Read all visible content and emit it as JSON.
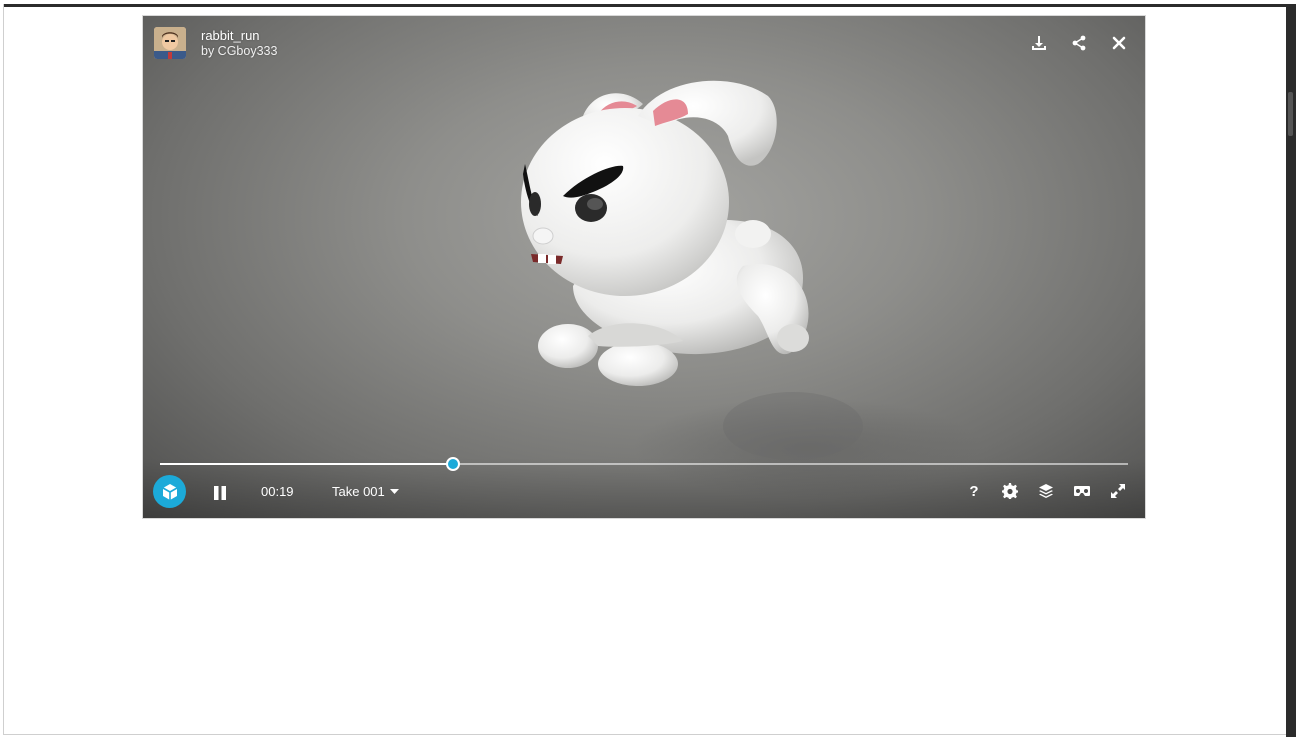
{
  "model": {
    "title": "rabbit_run",
    "author_line": "by CGboy333"
  },
  "top_actions": [
    {
      "name": "download-icon"
    },
    {
      "name": "share-icon"
    },
    {
      "name": "close-icon"
    }
  ],
  "player": {
    "time": "00:19",
    "take_label": "Take 001",
    "progress": 0.303
  },
  "bottom_actions": [
    {
      "name": "help-icon",
      "glyph": "?"
    },
    {
      "name": "settings-icon"
    },
    {
      "name": "layers-icon"
    },
    {
      "name": "vr-icon"
    },
    {
      "name": "fullscreen-icon"
    }
  ],
  "colors": {
    "accent": "#1caad9",
    "background_outer": "#ffffff",
    "viewer_center": "#a4a4a1",
    "viewer_edge": "#4e4e4d"
  }
}
